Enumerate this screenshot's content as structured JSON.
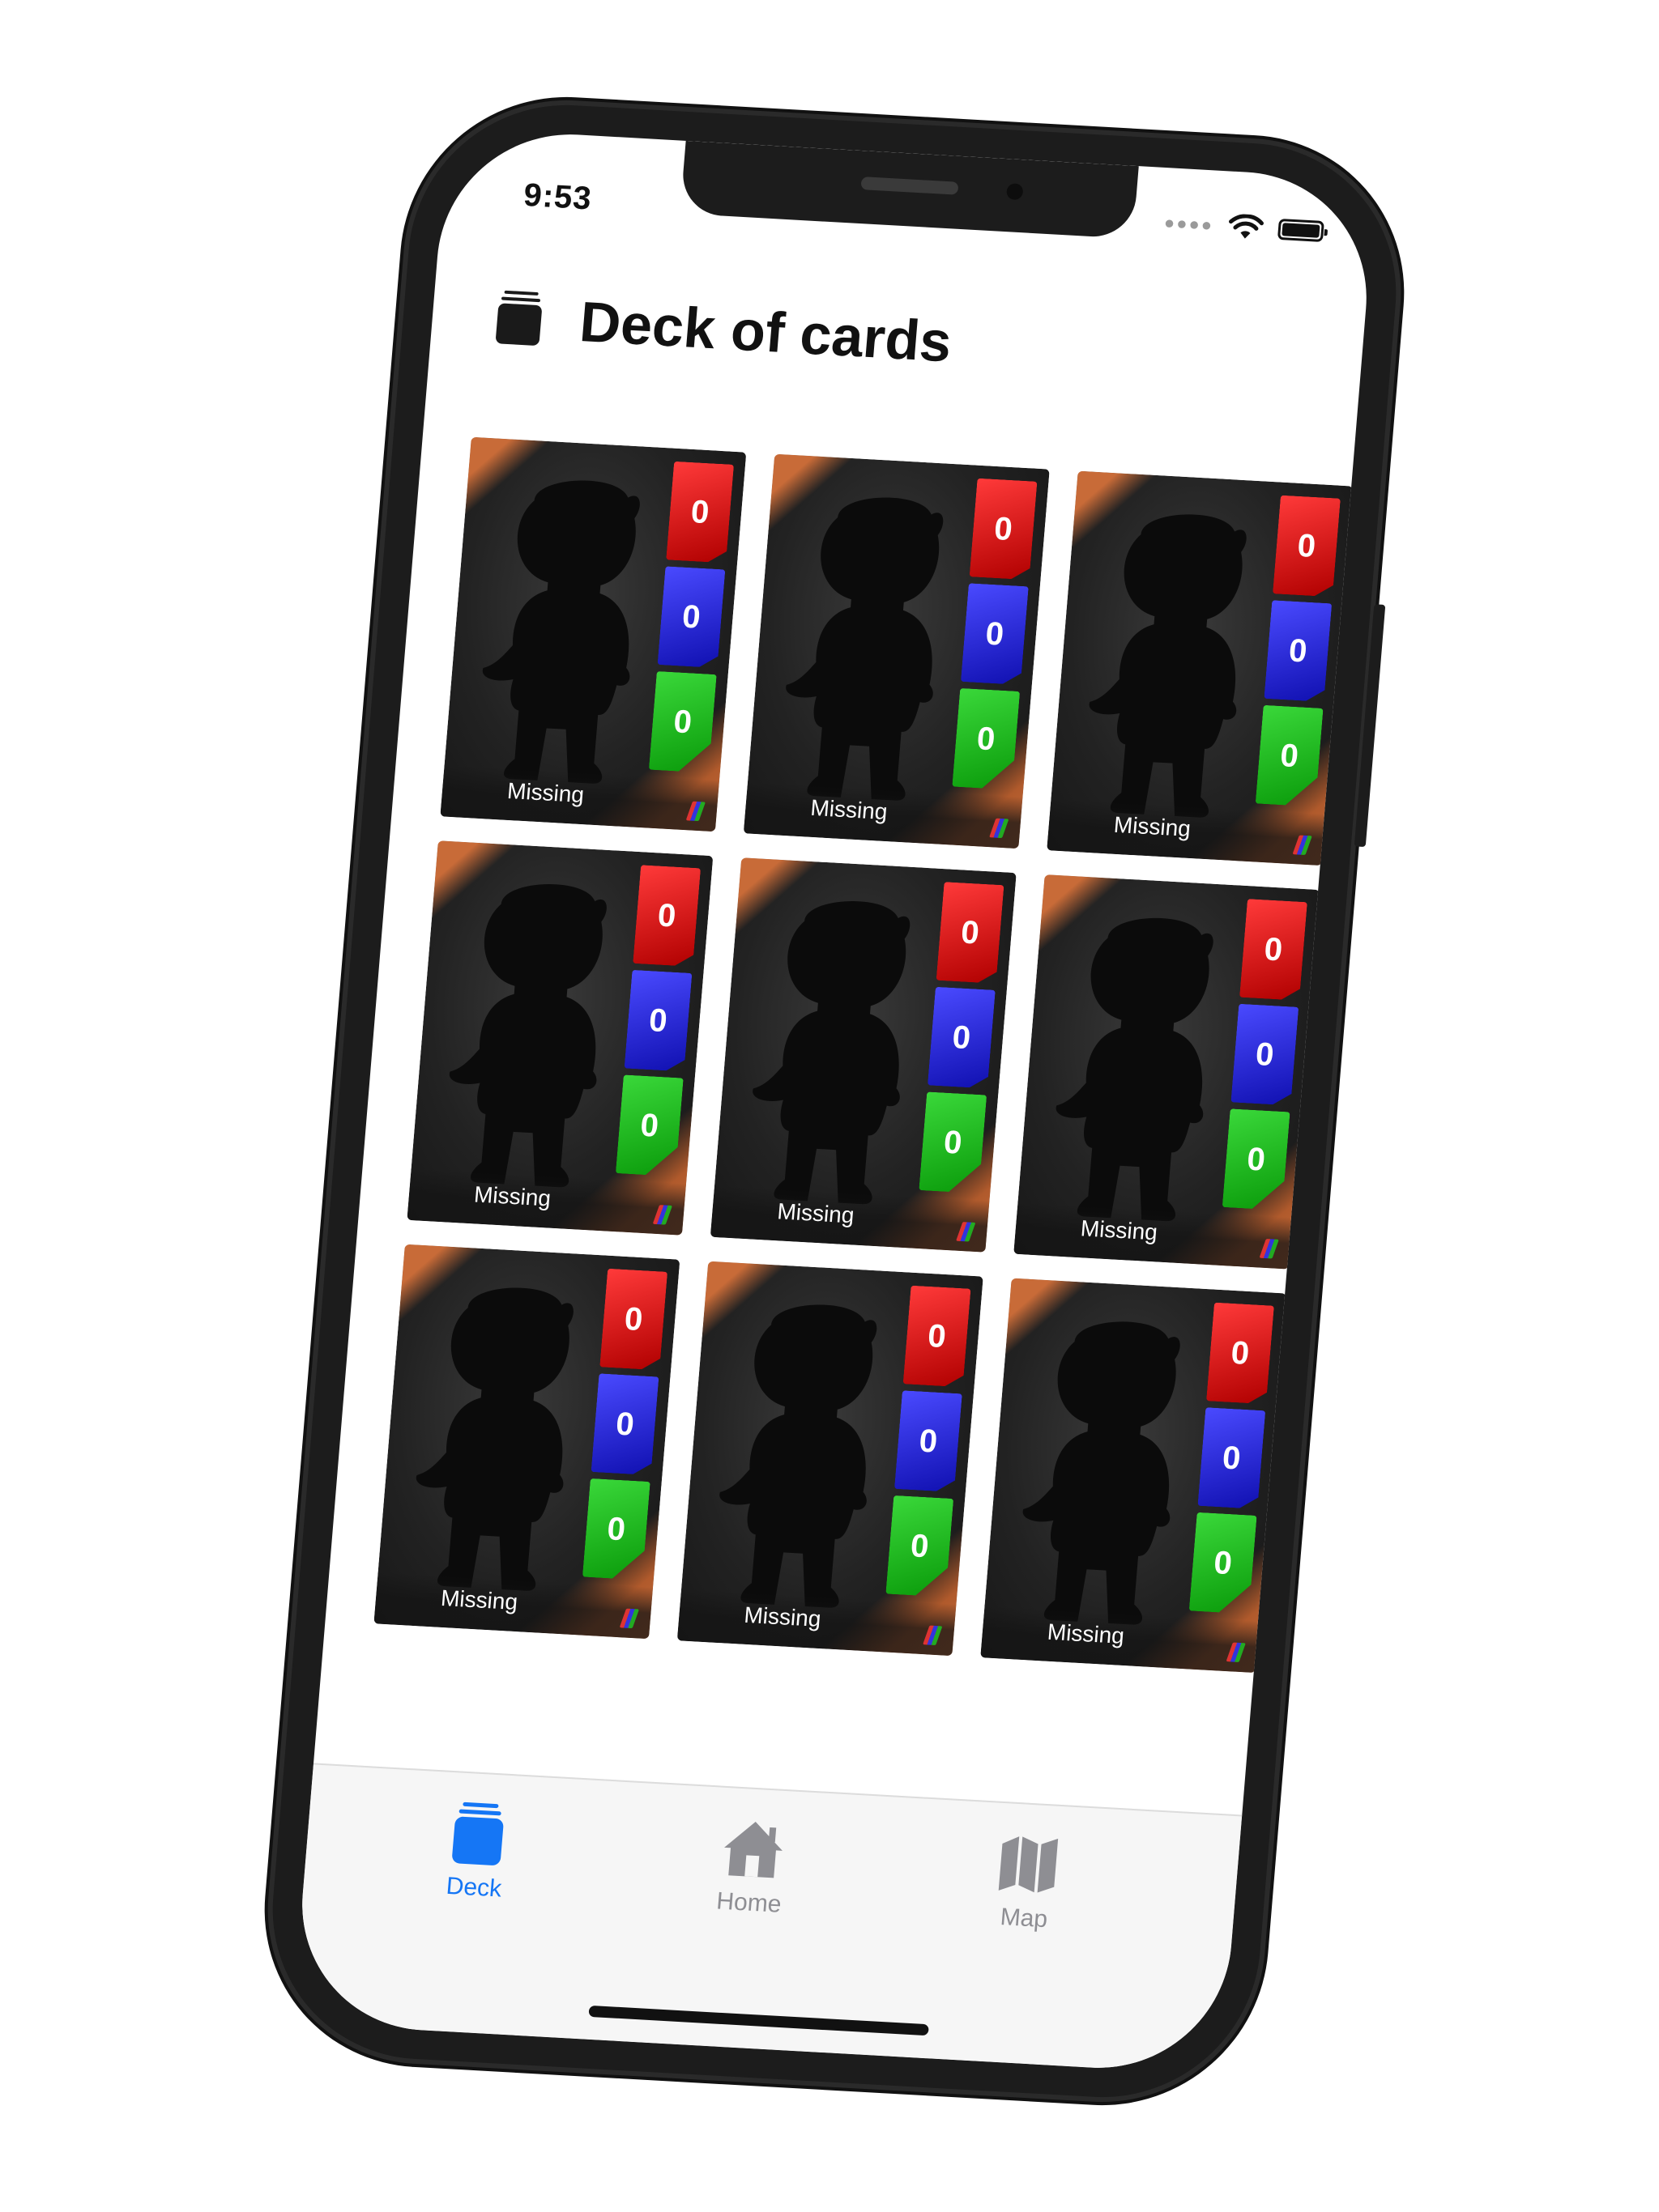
{
  "status": {
    "time": "9:53"
  },
  "header": {
    "title": "Deck of cards",
    "icon": "card-stack-icon"
  },
  "cards": [
    {
      "label": "Missing",
      "red": "0",
      "blue": "0",
      "green": "0"
    },
    {
      "label": "Missing",
      "red": "0",
      "blue": "0",
      "green": "0"
    },
    {
      "label": "Missing",
      "red": "0",
      "blue": "0",
      "green": "0"
    },
    {
      "label": "Missing",
      "red": "0",
      "blue": "0",
      "green": "0"
    },
    {
      "label": "Missing",
      "red": "0",
      "blue": "0",
      "green": "0"
    },
    {
      "label": "Missing",
      "red": "0",
      "blue": "0",
      "green": "0"
    },
    {
      "label": "Missing",
      "red": "0",
      "blue": "0",
      "green": "0"
    },
    {
      "label": "Missing",
      "red": "0",
      "blue": "0",
      "green": "0"
    },
    {
      "label": "Missing",
      "red": "0",
      "blue": "0",
      "green": "0"
    }
  ],
  "tabbar": {
    "items": [
      {
        "label": "Deck",
        "icon": "card-stack-icon",
        "active": true,
        "color": "#1576f5"
      },
      {
        "label": "Home",
        "icon": "house-icon",
        "active": false,
        "color": "#8e8e93"
      },
      {
        "label": "Map",
        "icon": "map-icon",
        "active": false,
        "color": "#8e8e93"
      }
    ]
  },
  "colors": {
    "accent": "#1576f5",
    "inactive": "#8e8e93",
    "stat_red": "#e01010",
    "stat_blue": "#2020e0",
    "stat_green": "#14b814",
    "card_accent": "#c86b38"
  }
}
